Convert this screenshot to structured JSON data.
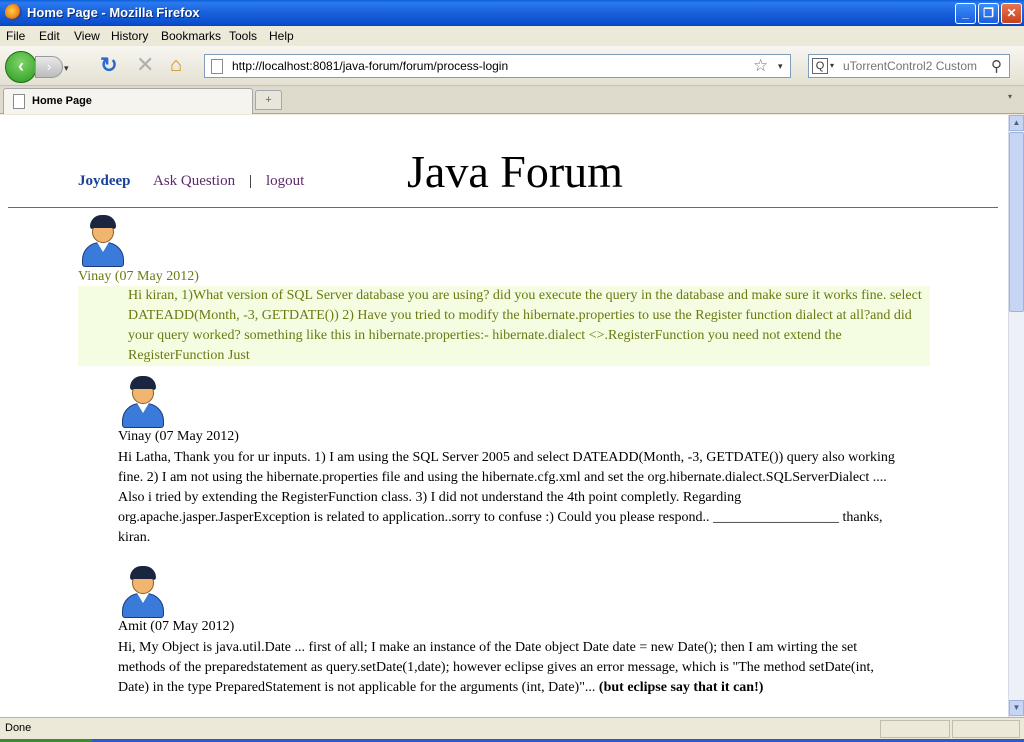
{
  "window": {
    "title": "Home Page - Mozilla Firefox",
    "min_label": "_",
    "max_label": "❐",
    "close_label": "✕"
  },
  "menu": [
    "File",
    "Edit",
    "View",
    "History",
    "Bookmarks",
    "Tools",
    "Help"
  ],
  "nav": {
    "back_glyph": "‹",
    "forward_glyph": "›",
    "dropdown_glyph": "▾",
    "reload_glyph": "↻",
    "stop_glyph": "✕",
    "home_glyph": "⌂",
    "url": "http://localhost:8081/java-forum/forum/process-login",
    "star_glyph": "☆",
    "search_placeholder": "uTorrentControl2 Custom",
    "search_engine_glyph": "Q",
    "magnifier_glyph": "⚲"
  },
  "tabs": {
    "active_label": "Home Page",
    "new_tab_glyph": "+",
    "list_glyph": "▾"
  },
  "page": {
    "user_name": "Joydeep",
    "ask_question": "Ask Question",
    "separator": "|",
    "logout": "logout",
    "site_title": "Java Forum",
    "posts": [
      {
        "poster": "Vinay  (07 May 2012)",
        "text": "Hi kiran, 1)What version of SQL Server database you are using? did you execute the query in the database and make sure it works fine. select DATEADD(Month, -3, GETDATE()) 2) Have you tried to modify the hibernate.properties to use the Register function dialect at all?and did your query worked? something like this in hibernate.properties:- hibernate.dialect <>.RegisterFunction you need not extend the RegisterFunction Just"
      },
      {
        "poster": "Vinay  (07 May 2012)",
        "text": "Hi Latha, Thank you for ur inputs. 1) I am using the SQL Server 2005 and select DATEADD(Month, -3, GETDATE()) query also working fine. 2) I am not using the hibernate.properties file and using the hibernate.cfg.xml and set the org.hibernate.dialect.SQLServerDialect .... Also i tried by extending the RegisterFunction class. 3) I did not understand the 4th point completly. Regarding org.apache.jasper.JasperException is related to application..sorry to confuse :) Could you please respond.. __________________ thanks, kiran."
      },
      {
        "poster": "Amit  (07 May 2012)",
        "text": "Hi, My Object is java.util.Date ... first of all; I make an instance of the Date object Date date = new Date(); then I am wirting the set methods of the preparedstatement as query.setDate(1,date); however eclipse gives an error message, which is \"The method setDate(int, Date) in the type PreparedStatement is not applicable for the arguments (int, Date)\"...",
        "bold_text": "(but eclipse say that it can!)"
      }
    ]
  },
  "scrollbar": {
    "up_glyph": "▲",
    "down_glyph": "▼"
  },
  "status": {
    "text": "Done"
  }
}
